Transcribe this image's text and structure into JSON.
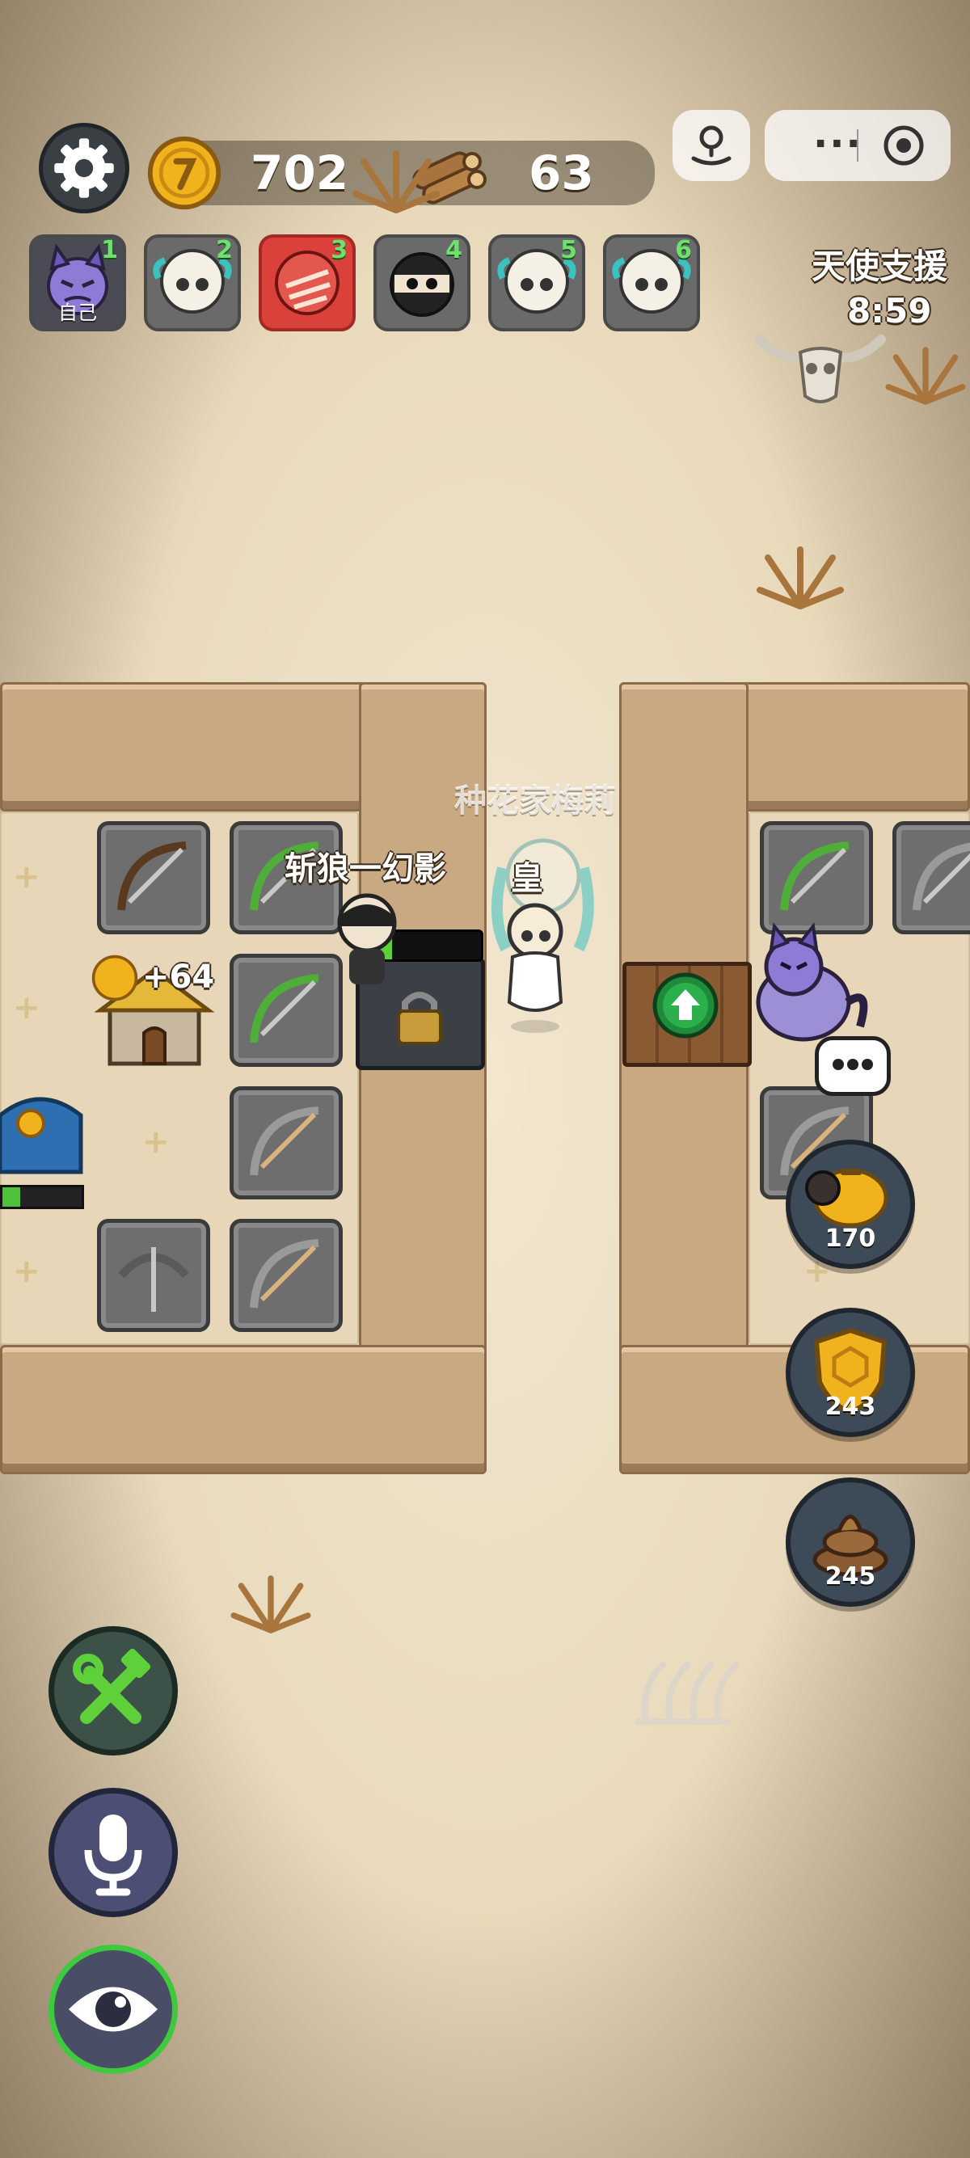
{
  "resources": {
    "coins": "702",
    "wood": "63"
  },
  "players": [
    {
      "num": "1",
      "label": "自己"
    },
    {
      "num": "2"
    },
    {
      "num": "3"
    },
    {
      "num": "4"
    },
    {
      "num": "5"
    },
    {
      "num": "6"
    }
  ],
  "angel": {
    "title": "天使支援",
    "timer": "8:59"
  },
  "world": {
    "enemy_name": "种花家梅莉",
    "player_name_1": "斩狼一幻影",
    "player_name_2": "皇",
    "gold_popup": "+64"
  },
  "side_buttons": [
    {
      "icon": "piggy-bank-icon",
      "count": "170"
    },
    {
      "icon": "shield-icon",
      "count": "243"
    },
    {
      "icon": "poop-icon",
      "count": "245"
    }
  ],
  "colors": {
    "accent_green": "#3fc93f",
    "gold": "#f0b21d",
    "panel_dark": "#3d4a57"
  }
}
